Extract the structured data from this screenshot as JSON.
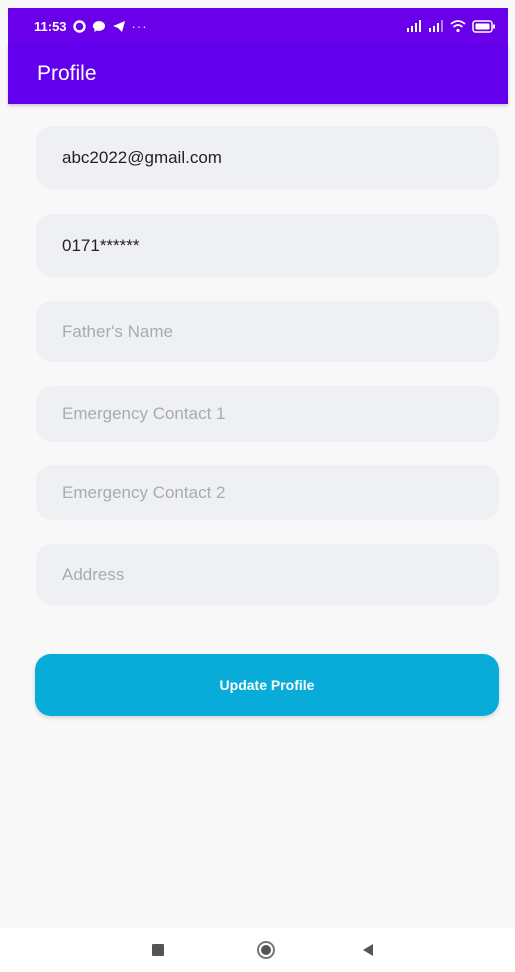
{
  "status_bar": {
    "time": "11:53",
    "more": "···"
  },
  "app_bar": {
    "title": "Profile"
  },
  "form": {
    "email": {
      "value": "abc2022@gmail.com",
      "placeholder": ""
    },
    "phone": {
      "value": "0171******",
      "placeholder": ""
    },
    "father_name": {
      "value": "",
      "placeholder": "Father's Name"
    },
    "emergency_contact_1": {
      "value": "",
      "placeholder": "Emergency Contact 1"
    },
    "emergency_contact_2": {
      "value": "",
      "placeholder": "Emergency Contact 2"
    },
    "address": {
      "value": "",
      "placeholder": "Address"
    }
  },
  "actions": {
    "update_label": "Update Profile"
  },
  "colors": {
    "app_bar": "#6200ee",
    "button": "#07acd9",
    "field_bg": "#eff0f3"
  },
  "nav": {
    "icons": [
      "square-recents-icon",
      "circle-home-icon",
      "triangle-back-icon"
    ]
  }
}
